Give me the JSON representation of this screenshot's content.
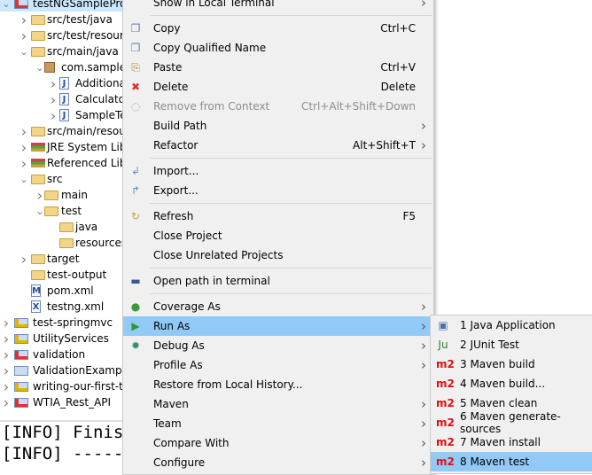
{
  "tree": [
    {
      "label": "testNGSampleProject",
      "level": 0,
      "chevron": "down",
      "icon": "maven-project-error-icon",
      "selected": true
    },
    {
      "label": "src/test/java",
      "level": 1,
      "chevron": "right",
      "icon": "source-folder-icon"
    },
    {
      "label": "src/test/resources",
      "level": 1,
      "chevron": "right",
      "icon": "source-folder-icon"
    },
    {
      "label": "src/main/java",
      "level": 1,
      "chevron": "down",
      "icon": "source-folder-icon"
    },
    {
      "label": "com.sample",
      "level": 2,
      "chevron": "down",
      "icon": "package-icon"
    },
    {
      "label": "AdditionalTest",
      "level": 3,
      "chevron": "right",
      "icon": "java-file-icon"
    },
    {
      "label": "CalculatorTest",
      "level": 3,
      "chevron": "right",
      "icon": "java-file-icon"
    },
    {
      "label": "SampleTest",
      "level": 3,
      "chevron": "right",
      "icon": "java-file-icon"
    },
    {
      "label": "src/main/resources",
      "level": 1,
      "chevron": "right",
      "icon": "source-folder-icon"
    },
    {
      "label": "JRE System Library",
      "level": 1,
      "chevron": "right",
      "icon": "library-icon"
    },
    {
      "label": "Referenced Libraries",
      "level": 1,
      "chevron": "right",
      "icon": "library-icon"
    },
    {
      "label": "src",
      "level": 1,
      "chevron": "down",
      "icon": "folder-icon"
    },
    {
      "label": "main",
      "level": 2,
      "chevron": "right",
      "icon": "folder-icon"
    },
    {
      "label": "test",
      "level": 2,
      "chevron": "down",
      "icon": "folder-icon"
    },
    {
      "label": "java",
      "level": 3,
      "chevron": "",
      "icon": "folder-icon"
    },
    {
      "label": "resources",
      "level": 3,
      "chevron": "",
      "icon": "folder-icon"
    },
    {
      "label": "target",
      "level": 1,
      "chevron": "right",
      "icon": "folder-icon"
    },
    {
      "label": "test-output",
      "level": 1,
      "chevron": "",
      "icon": "folder-icon"
    },
    {
      "label": "pom.xml",
      "level": 1,
      "chevron": "",
      "icon": "maven-pom-icon"
    },
    {
      "label": "testng.xml",
      "level": 1,
      "chevron": "",
      "icon": "xml-file-icon"
    },
    {
      "label": "test-springmvc",
      "level": 0,
      "chevron": "right",
      "icon": "maven-project-warning-icon"
    },
    {
      "label": "UtilityServices",
      "level": 0,
      "chevron": "right",
      "icon": "maven-project-warning-icon"
    },
    {
      "label": "validation",
      "level": 0,
      "chevron": "right",
      "icon": "project-error-icon"
    },
    {
      "label": "ValidationExample (",
      "level": 0,
      "chevron": "right",
      "icon": "maven-project-icon"
    },
    {
      "label": "writing-our-first-test",
      "level": 0,
      "chevron": "right",
      "icon": "maven-project-warning-icon"
    },
    {
      "label": "WTIA_Rest_API",
      "level": 0,
      "chevron": "right",
      "icon": "maven-project-error-icon"
    }
  ],
  "console": [
    "[INFO] Finis",
    "[INFO] -----"
  ],
  "menu": [
    {
      "label": "Show in Local Terminal",
      "arrow": true
    },
    {
      "sep": true
    },
    {
      "label": "Copy",
      "shortcut": "Ctrl+C",
      "icon": "copy-icon"
    },
    {
      "label": "Copy Qualified Name",
      "icon": "copy-qualified-name-icon"
    },
    {
      "label": "Paste",
      "shortcut": "Ctrl+V",
      "icon": "paste-icon"
    },
    {
      "label": "Delete",
      "shortcut": "Delete",
      "icon": "delete-icon"
    },
    {
      "label": "Remove from Context",
      "shortcut": "Ctrl+Alt+Shift+Down",
      "icon": "remove-context-icon",
      "disabled": true
    },
    {
      "label": "Build Path",
      "arrow": true
    },
    {
      "label": "Refactor",
      "shortcut": "Alt+Shift+T",
      "arrow": true
    },
    {
      "sep": true
    },
    {
      "label": "Import...",
      "icon": "import-icon"
    },
    {
      "label": "Export...",
      "icon": "export-icon"
    },
    {
      "sep": true
    },
    {
      "label": "Refresh",
      "shortcut": "F5",
      "icon": "refresh-icon"
    },
    {
      "label": "Close Project"
    },
    {
      "label": "Close Unrelated Projects"
    },
    {
      "sep": true
    },
    {
      "label": "Open path in terminal",
      "icon": "terminal-icon"
    },
    {
      "sep": true
    },
    {
      "label": "Coverage As",
      "arrow": true,
      "icon": "coverage-icon"
    },
    {
      "label": "Run As",
      "arrow": true,
      "icon": "run-icon",
      "highlighted": true
    },
    {
      "label": "Debug As",
      "arrow": true,
      "icon": "debug-icon"
    },
    {
      "label": "Profile As",
      "arrow": true
    },
    {
      "label": "Restore from Local History..."
    },
    {
      "label": "Maven",
      "arrow": true
    },
    {
      "label": "Team",
      "arrow": true
    },
    {
      "label": "Compare With",
      "arrow": true
    },
    {
      "label": "Configure",
      "arrow": true
    }
  ],
  "submenu": [
    {
      "label": "1 Java Application",
      "icon": "java-application-icon"
    },
    {
      "label": "2 JUnit Test",
      "icon": "junit-icon",
      "icon_text": "Ju"
    },
    {
      "label": "3 Maven build",
      "icon": "maven-icon",
      "icon_text": "m2"
    },
    {
      "label": "4 Maven build...",
      "icon": "maven-icon",
      "icon_text": "m2"
    },
    {
      "label": "5 Maven clean",
      "icon": "maven-icon",
      "icon_text": "m2"
    },
    {
      "label": "6 Maven generate-sources",
      "icon": "maven-icon",
      "icon_text": "m2"
    },
    {
      "label": "7 Maven install",
      "icon": "maven-icon",
      "icon_text": "m2"
    },
    {
      "label": "8 Maven test",
      "icon": "maven-icon",
      "icon_text": "m2",
      "highlighted": true
    }
  ],
  "colors": {
    "highlight": "#91c9f7",
    "menu_bg": "#f0f0f0",
    "maven": "#e01010",
    "selection": "#cce8ff"
  }
}
